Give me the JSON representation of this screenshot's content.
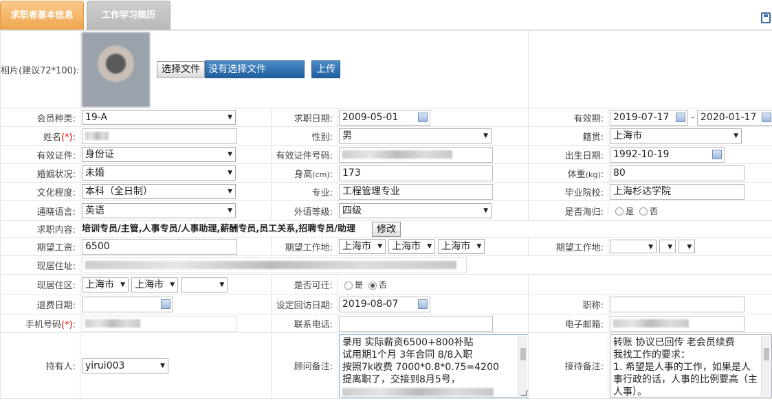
{
  "tabs": [
    {
      "label": "求职者基本信息"
    },
    {
      "label": "工作学习简历"
    }
  ],
  "photo": {
    "label": "相片(建议72*100):",
    "choose_file": "选择文件",
    "no_file": "没有选择文件",
    "upload": "上传"
  },
  "member_type": {
    "label": "会员种类:",
    "value": "19-A"
  },
  "job_date": {
    "label": "求职日期:",
    "value": "2009-05-01"
  },
  "validity": {
    "label": "有效期:",
    "start": "2019-07-17",
    "sep": "-",
    "end": "2020-01-17"
  },
  "name": {
    "label": "姓名",
    "req": "(*)",
    ":": ":"
  },
  "gender": {
    "label": "性别:",
    "value": "男"
  },
  "native_place": {
    "label": "籍贯:",
    "value": "上海市"
  },
  "id_type": {
    "label": "有效证件:",
    "value": "身份证"
  },
  "id_number": {
    "label": "有效证件号码:"
  },
  "birth_date": {
    "label": "出生日期:",
    "value": "1992-10-19"
  },
  "marital": {
    "label": "婚姻状况:",
    "value": "未婚"
  },
  "height": {
    "label": "身高",
    "unit": "(cm)",
    "colon": ":",
    "value": "173"
  },
  "weight": {
    "label": "体重",
    "unit": "(kg)",
    "colon": ":",
    "value": "80"
  },
  "education": {
    "label": "文化程度:",
    "value": "本科（全日制）"
  },
  "major": {
    "label": "专业:",
    "value": "工程管理专业"
  },
  "school": {
    "label": "毕业院校:",
    "value": "上海杉达学院"
  },
  "language": {
    "label": "通晓语言:",
    "value": "英语"
  },
  "lang_level": {
    "label": "外语等级:",
    "value": "四级"
  },
  "returnee": {
    "label": "是否海归:",
    "yes": "是",
    "no": "否"
  },
  "job_content": {
    "label": "求职内容:",
    "value": "培训专员/主管,人事专员/人事助理,薪酬专员,员工关系,招聘专员/助理",
    "edit": "修改"
  },
  "salary": {
    "label": "期望工资:",
    "value": "6500"
  },
  "work_place1": {
    "label": "期望工作地:",
    "a": "上海市",
    "b": "上海市",
    "c": "上海市"
  },
  "work_place2": {
    "label": "期望工作地:"
  },
  "address": {
    "label": "现居住址:"
  },
  "district": {
    "label": "现居住区:",
    "a": "上海市",
    "b": "上海市"
  },
  "relocate": {
    "label": "是否可迁:",
    "yes": "是",
    "no": "否"
  },
  "refund_date": {
    "label": "退费日期:"
  },
  "visit_date": {
    "label": "设定回访日期:",
    "value": "2019-08-07"
  },
  "title": {
    "label": "职称:"
  },
  "mobile": {
    "label": "手机号码",
    "req": "(*)",
    "colon": ":"
  },
  "phone": {
    "label": "联系电话:"
  },
  "email": {
    "label": "电子邮箱:"
  },
  "holder": {
    "label": "持有人:",
    "value": "yirui003"
  },
  "consultant_note": {
    "label": "顾问备注:",
    "lines": [
      "录用 实际薪资6500+800补贴",
      "试用期1个月 3年合同 8/8入职",
      "按照7k收费 7000*0.8*0.75=4200",
      "提离职了，交接到8月5号，"
    ]
  },
  "reception_note": {
    "label": "接待备注:",
    "lines": [
      "转账 协议已回传 老会员续费",
      "我找工作的要求：",
      "1. 希望是人事的工作，如果是人事行政的话，人事的比例要高（主人事）。"
    ]
  }
}
